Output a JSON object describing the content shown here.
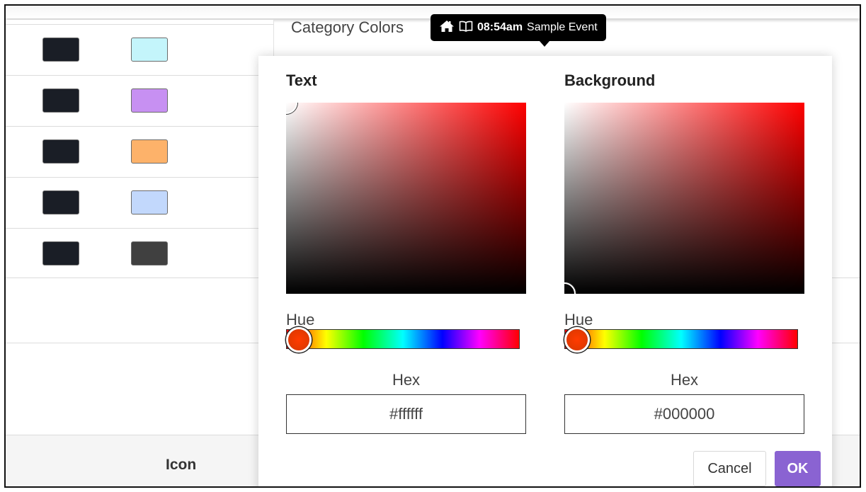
{
  "category_colors": {
    "title": "Category Colors",
    "rows": [
      {
        "text_color": "#1a1e26",
        "bg_color": "#c4f5fb"
      },
      {
        "text_color": "#1a1e26",
        "bg_color": "#c790f2"
      },
      {
        "text_color": "#1a1e26",
        "bg_color": "#fdb26a"
      },
      {
        "text_color": "#1a1e26",
        "bg_color": "#c2d8fc"
      },
      {
        "text_color": "#1a1e26",
        "bg_color": "#404040"
      }
    ]
  },
  "table_footer": {
    "icon_header": "Icon"
  },
  "tooltip": {
    "home_icon": "home-icon",
    "book_icon": "book-icon",
    "time": "08:54am",
    "event": "Sample Event"
  },
  "color_dialog": {
    "text_picker": {
      "title": "Text",
      "hue_label": "Hue",
      "hex_label": "Hex",
      "hex_value": "#ffffff",
      "hue": 0,
      "saturation": 0,
      "brightness": 1
    },
    "background_picker": {
      "title": "Background",
      "hue_label": "Hue",
      "hex_label": "Hex",
      "hex_value": "#000000",
      "hue": 0,
      "saturation": 0,
      "brightness": 0
    },
    "cancel_label": "Cancel",
    "ok_label": "OK",
    "accent_color": "#8a63d2"
  }
}
